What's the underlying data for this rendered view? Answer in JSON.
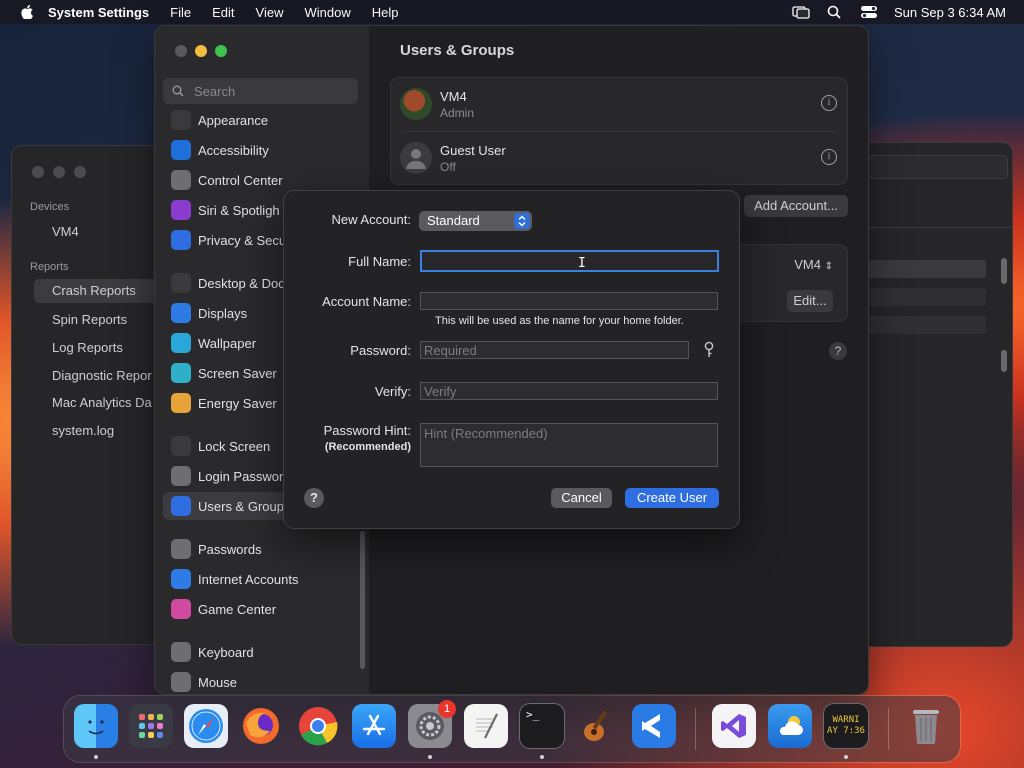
{
  "menubar": {
    "app": "System Settings",
    "items": [
      "File",
      "Edit",
      "View",
      "Window",
      "Help"
    ],
    "clock": "Sun Sep 3  6:34 AM"
  },
  "console": {
    "devices_header": "Devices",
    "device": "VM4",
    "reports_header": "Reports",
    "reports": [
      "Crash Reports",
      "Spin Reports",
      "Log Reports",
      "Diagnostic Repor",
      "Mac Analytics Da",
      "system.log"
    ]
  },
  "settings": {
    "search_placeholder": "Search",
    "sidebar": [
      {
        "label": "Appearance",
        "icon": "appearance-icon",
        "color": "#3a3a3c"
      },
      {
        "label": "Accessibility",
        "icon": "accessibility-icon",
        "color": "#1e6fd9"
      },
      {
        "label": "Control Center",
        "icon": "control-center-icon",
        "color": "#6e6e72"
      },
      {
        "label": "Siri & Spotligh",
        "icon": "siri-icon",
        "color": "#8a3ccf"
      },
      {
        "label": "Privacy & Secu",
        "icon": "privacy-hand-icon",
        "color": "#2e6ee0"
      },
      {
        "label": "Desktop & Doc",
        "icon": "desktop-dock-icon",
        "color": "#3a3a3c"
      },
      {
        "label": "Displays",
        "icon": "displays-icon",
        "color": "#2e7be6"
      },
      {
        "label": "Wallpaper",
        "icon": "wallpaper-icon",
        "color": "#2aa6d8"
      },
      {
        "label": "Screen Saver",
        "icon": "screen-saver-icon",
        "color": "#30b0c8"
      },
      {
        "label": "Energy Saver",
        "icon": "energy-saver-icon",
        "color": "#e8a23a"
      },
      {
        "label": "Lock Screen",
        "icon": "lock-screen-icon",
        "color": "#3a3a3c"
      },
      {
        "label": "Login Passwor",
        "icon": "login-password-icon",
        "color": "#6e6e72"
      },
      {
        "label": "Users & Group",
        "icon": "users-groups-icon",
        "color": "#2e6ee0"
      },
      {
        "label": "Passwords",
        "icon": "passwords-key-icon",
        "color": "#6e6e72"
      },
      {
        "label": "Internet Accounts",
        "icon": "internet-accounts-icon",
        "color": "#2e7be6"
      },
      {
        "label": "Game Center",
        "icon": "game-center-icon",
        "color": "#d04aa0"
      },
      {
        "label": "Keyboard",
        "icon": "keyboard-icon",
        "color": "#6e6e72"
      },
      {
        "label": "Mouse",
        "icon": "mouse-icon",
        "color": "#6e6e72"
      }
    ],
    "title": "Users & Groups",
    "users": [
      {
        "name": "VM4",
        "role": "Admin"
      },
      {
        "name": "Guest User",
        "role": "Off"
      }
    ],
    "add_account": "Add Account...",
    "autologin_value": "VM4",
    "edit": "Edit..."
  },
  "dialog": {
    "new_account_label": "New Account:",
    "account_type": "Standard",
    "full_name_label": "Full Name:",
    "full_name_value": "",
    "account_name_label": "Account Name:",
    "account_name_value": "",
    "account_name_note": "This will be used as the name for your home folder.",
    "password_label": "Password:",
    "password_placeholder": "Required",
    "verify_label": "Verify:",
    "verify_placeholder": "Verify",
    "hint_label": "Password Hint:",
    "hint_sublabel": "(Recommended)",
    "hint_placeholder": "Hint (Recommended)",
    "help": "?",
    "cancel": "Cancel",
    "create": "Create User"
  },
  "dock": {
    "settings_badge": "1",
    "console_warning_line1": "WARNI",
    "console_warning_line2": "AY 7:36"
  }
}
